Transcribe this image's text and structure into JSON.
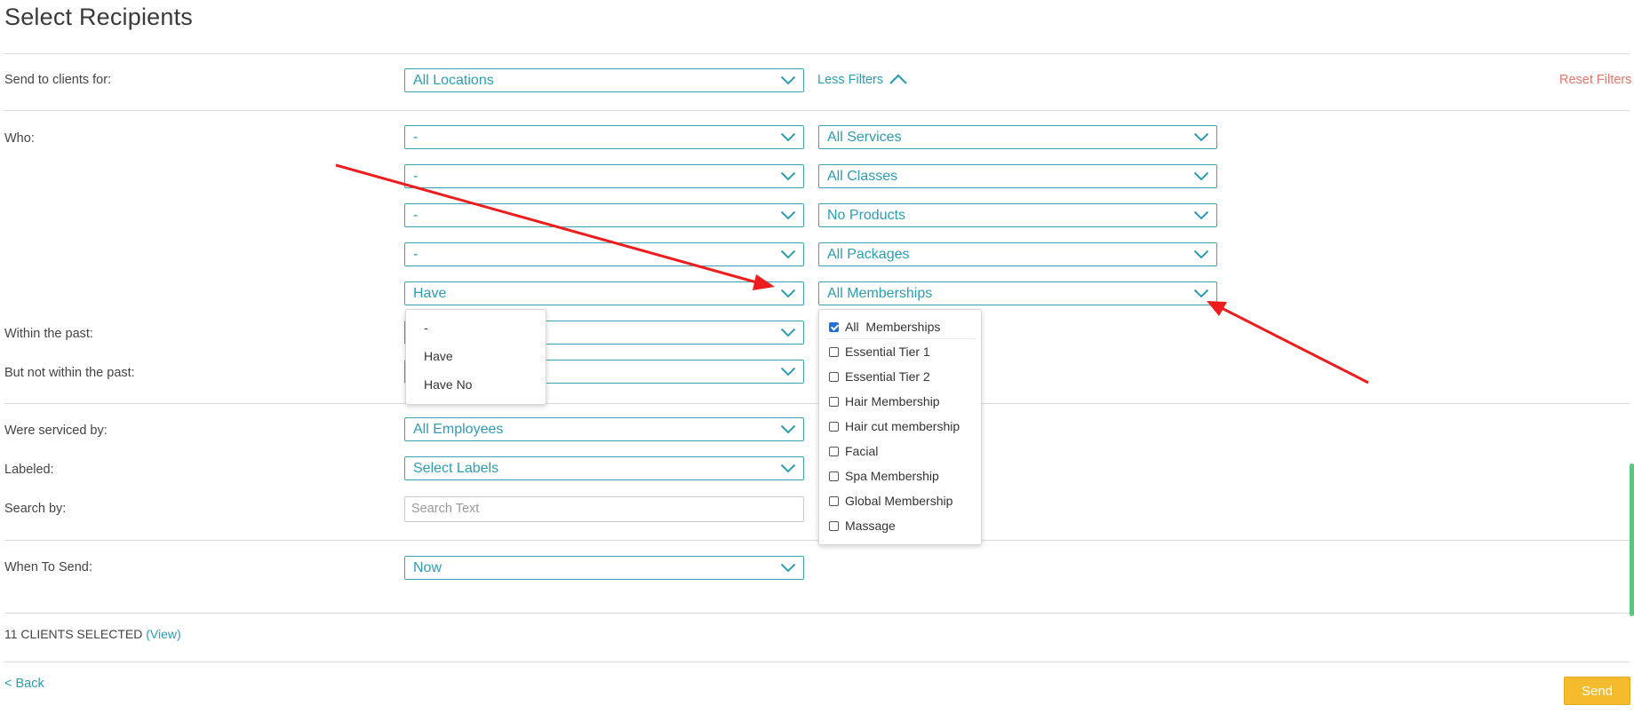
{
  "page": {
    "title": "Select Recipients"
  },
  "rows": {
    "send_to": {
      "label": "Send to clients for:",
      "value": "All Locations"
    },
    "less_filters": "Less Filters",
    "reset_filters": "Reset Filters",
    "who_label": "Who:",
    "who_filters": [
      {
        "qualifier": "-",
        "item": "All Services"
      },
      {
        "qualifier": "-",
        "item": "All Classes"
      },
      {
        "qualifier": "-",
        "item": "No Products"
      },
      {
        "qualifier": "-",
        "item": "All Packages"
      },
      {
        "qualifier": "Have",
        "item": "All Memberships"
      }
    ],
    "within_past_label": "Within the past:",
    "not_within_past_label": "But not within the past:",
    "serviced_by": {
      "label": "Were serviced by:",
      "value": "All Employees"
    },
    "labeled": {
      "label": "Labeled:",
      "value": "Select Labels"
    },
    "search": {
      "label": "Search by:",
      "placeholder": "Search Text"
    },
    "when": {
      "label": "When To Send:",
      "value": "Now"
    }
  },
  "qualifier_menu": {
    "options": [
      "-",
      "Have",
      "Have No"
    ]
  },
  "membership_menu": {
    "options": [
      {
        "label": "All  Memberships",
        "checked": true
      },
      {
        "label": "Essential Tier 1",
        "checked": false
      },
      {
        "label": "Essential Tier 2",
        "checked": false
      },
      {
        "label": "Hair Membership",
        "checked": false
      },
      {
        "label": "Hair cut membership",
        "checked": false
      },
      {
        "label": "Facial",
        "checked": false
      },
      {
        "label": "Spa Membership",
        "checked": false
      },
      {
        "label": "Global Membership",
        "checked": false
      },
      {
        "label": "Massage",
        "checked": false
      }
    ]
  },
  "footer": {
    "clients_selected": "11 CLIENTS SELECTED",
    "view_link": "(View)",
    "back_link": "< Back",
    "send_button": "Send"
  },
  "icons": {
    "dropdown": "chevron-down-icon",
    "collapse": "chevron-up-icon"
  },
  "colors": {
    "accent": "#2c9db0",
    "reset": "#e8756a",
    "send": "#f5bb2c",
    "annotation_arrow": "#ee1c1c",
    "checkbox_checked": "#1f6fd6"
  }
}
